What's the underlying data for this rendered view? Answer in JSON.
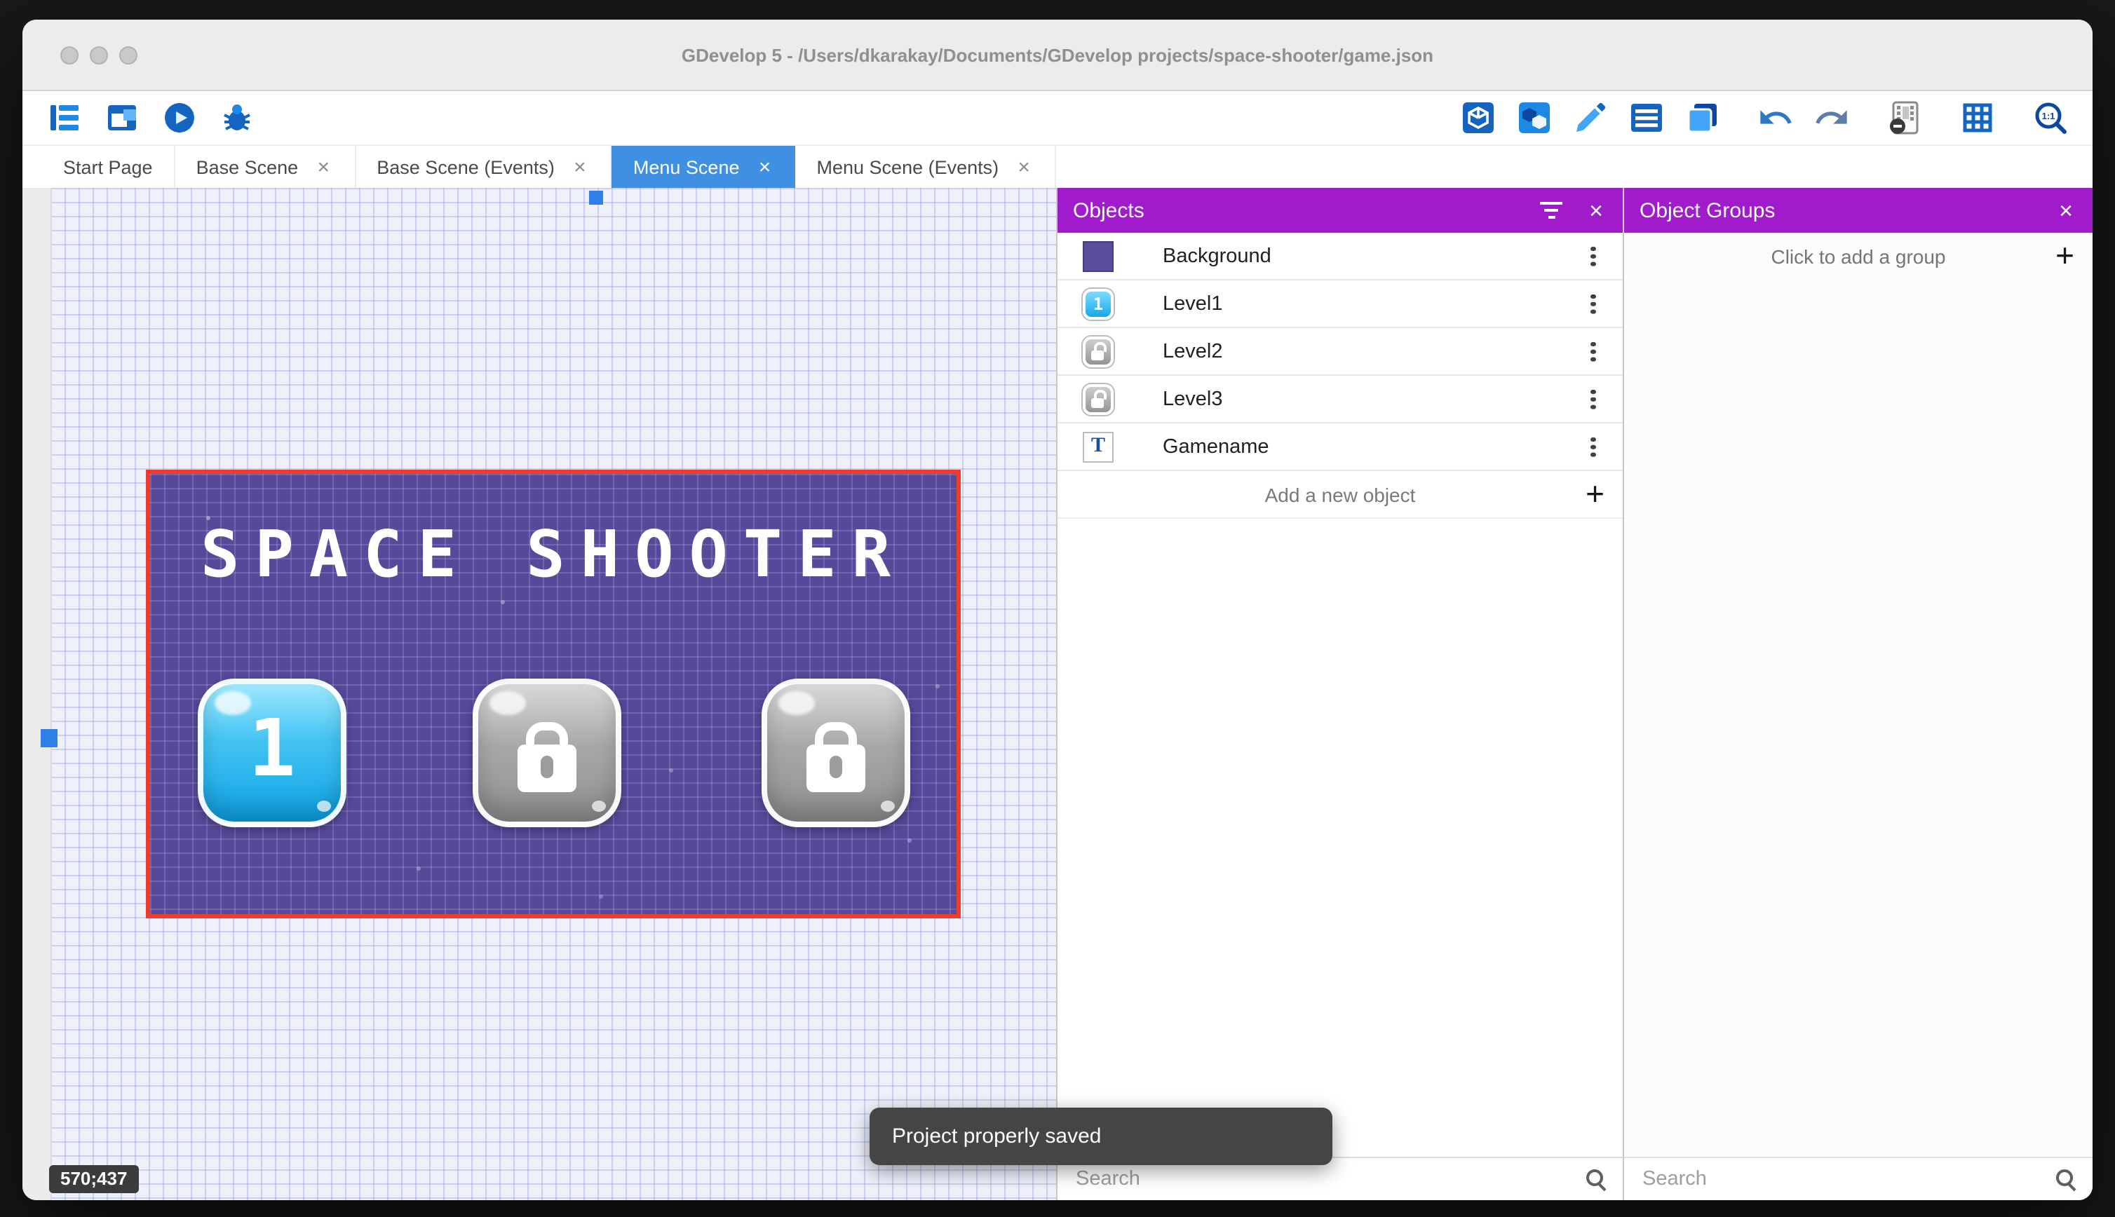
{
  "window": {
    "title": "GDevelop 5 - /Users/dkarakay/Documents/GDevelop projects/space-shooter/game.json"
  },
  "toolbar": {
    "left_icons": [
      "project-manager",
      "scene-window",
      "play-preview",
      "debugger"
    ],
    "right_icons": [
      "objects-editor",
      "object-groups-editor",
      "properties",
      "instances-list",
      "layers",
      "undo",
      "redo",
      "render-options",
      "grid",
      "zoom"
    ],
    "zoom_label": "1:1"
  },
  "tabs": [
    {
      "label": "Start Page",
      "active": false,
      "closable": false
    },
    {
      "label": "Base Scene",
      "active": false,
      "closable": true
    },
    {
      "label": "Base Scene (Events)",
      "active": false,
      "closable": true
    },
    {
      "label": "Menu Scene",
      "active": true,
      "closable": true
    },
    {
      "label": "Menu Scene (Events)",
      "active": false,
      "closable": true
    }
  ],
  "canvas": {
    "coordinates_indicator": "570;437",
    "scene": {
      "title": "SPACE SHOOTER",
      "buttons": [
        {
          "label": "1",
          "state": "unlocked"
        },
        {
          "label": "",
          "state": "locked"
        },
        {
          "label": "",
          "state": "locked"
        }
      ]
    }
  },
  "objects_panel": {
    "title": "Objects",
    "items": [
      {
        "name": "Background",
        "icon": "purple-swatch",
        "badge": ""
      },
      {
        "name": "Level1",
        "icon": "blue-level-button",
        "badge": "1"
      },
      {
        "name": "Level2",
        "icon": "locked-level-button",
        "badge": ""
      },
      {
        "name": "Level3",
        "icon": "locked-level-button",
        "badge": ""
      },
      {
        "name": "Gamename",
        "icon": "text-object",
        "badge": "T"
      }
    ],
    "add_button_label": "Add a new object",
    "search_placeholder": "Search"
  },
  "object_groups_panel": {
    "title": "Object Groups",
    "empty_cta": "Click to add a group",
    "search_placeholder": "Search"
  },
  "toast": {
    "message": "Project properly saved"
  },
  "colors": {
    "header_purple": "#A01BC9",
    "active_tab_blue": "#3F8FE3",
    "selection_red": "#F03B2B",
    "scene_purple": "#57499A",
    "canvas_grid": "#C9CFF1",
    "toolbar_blue": "#1565C0"
  }
}
